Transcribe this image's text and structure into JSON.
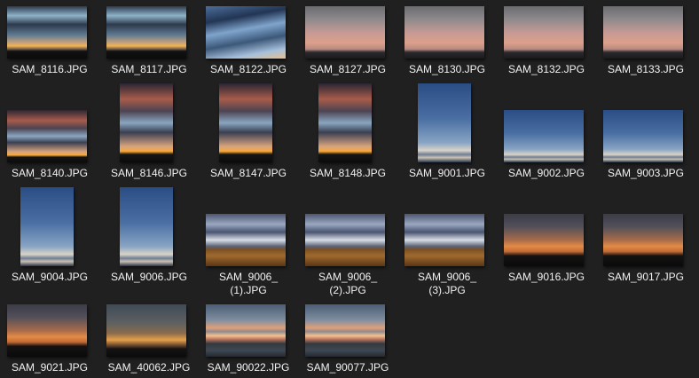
{
  "files": [
    {
      "name": "SAM_8116.JPG",
      "orientation": "landscape",
      "look": "sunset"
    },
    {
      "name": "SAM_8117.JPG",
      "orientation": "landscape",
      "look": "sunset"
    },
    {
      "name": "SAM_8122.JPG",
      "orientation": "landscape",
      "look": "blueclouds"
    },
    {
      "name": "SAM_8127.JPG",
      "orientation": "landscape",
      "look": "pink"
    },
    {
      "name": "SAM_8130.JPG",
      "orientation": "landscape",
      "look": "pink"
    },
    {
      "name": "SAM_8132.JPG",
      "orientation": "landscape",
      "look": "pink"
    },
    {
      "name": "SAM_8133.JPG",
      "orientation": "landscape",
      "look": "pink"
    },
    {
      "name": "SAM_8140.JPG",
      "orientation": "landscape",
      "look": "red"
    },
    {
      "name": "SAM_8146.JPG",
      "orientation": "portrait",
      "look": "red"
    },
    {
      "name": "SAM_8147.JPG",
      "orientation": "portrait",
      "look": "red"
    },
    {
      "name": "SAM_8148.JPG",
      "orientation": "portrait",
      "look": "red"
    },
    {
      "name": "SAM_9001.JPG",
      "orientation": "portrait",
      "look": "clear"
    },
    {
      "name": "SAM_9002.JPG",
      "orientation": "landscape",
      "look": "clear"
    },
    {
      "name": "SAM_9003.JPG",
      "orientation": "landscape",
      "look": "clear"
    },
    {
      "name": "SAM_9004.JPG",
      "orientation": "portrait",
      "look": "clear"
    },
    {
      "name": "SAM_9006.JPG",
      "orientation": "portrait",
      "look": "clear"
    },
    {
      "name": "SAM_9006_\n(1).JPG",
      "orientation": "landscape",
      "look": "field"
    },
    {
      "name": "SAM_9006_\n(2).JPG",
      "orientation": "landscape",
      "look": "field"
    },
    {
      "name": "SAM_9006_\n(3).JPG",
      "orientation": "landscape",
      "look": "field"
    },
    {
      "name": "SAM_9016.JPG",
      "orientation": "landscape",
      "look": "haze"
    },
    {
      "name": "SAM_9017.JPG",
      "orientation": "landscape",
      "look": "haze"
    },
    {
      "name": "SAM_9021.JPG",
      "orientation": "landscape",
      "look": "haze"
    },
    {
      "name": "SAM_40062.JPG",
      "orientation": "landscape",
      "look": "dusk"
    },
    {
      "name": "SAM_90022.JPG",
      "orientation": "landscape",
      "look": "streaks"
    },
    {
      "name": "SAM_90077.JPG",
      "orientation": "landscape",
      "look": "streaks"
    }
  ]
}
